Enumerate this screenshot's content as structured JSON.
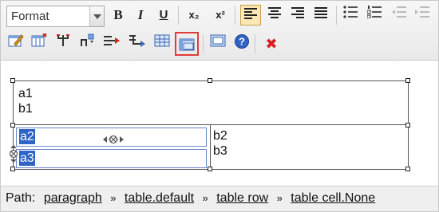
{
  "toolbar": {
    "format_value": "Format",
    "bold": "B",
    "italic": "I",
    "underline": "U",
    "subscript": "x₂",
    "superscript": "x²",
    "remove": "✖"
  },
  "editor": {
    "row1_cells": [
      "a1",
      "b1"
    ],
    "row2_col1": [
      "a2",
      "a3"
    ],
    "row2_col2": [
      "b2",
      "b3"
    ]
  },
  "path": {
    "label": "Path:",
    "separator": "»",
    "items": [
      "paragraph",
      "table.default",
      "table row",
      "table cell.None"
    ]
  }
}
